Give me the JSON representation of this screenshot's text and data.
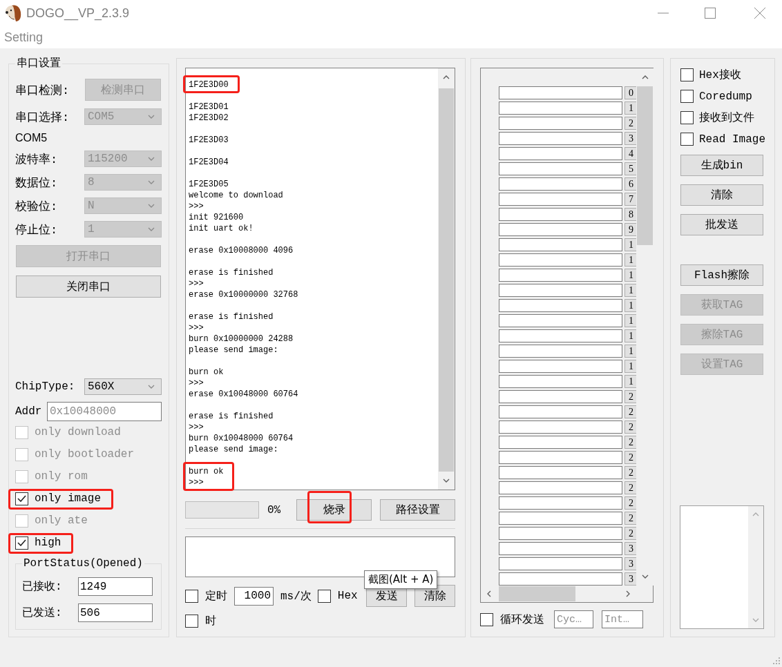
{
  "window": {
    "title": "DOGO__VP_2.3.9"
  },
  "menu": [
    {
      "label": "Setting"
    }
  ],
  "serial_settings": {
    "title": "串口设置",
    "detect": {
      "label": "串口检测:",
      "button": "检测串口",
      "disabled": true
    },
    "port_select": {
      "label": "串口选择:",
      "value": "COM5",
      "disabled": true
    },
    "port_name": "COM5",
    "params": [
      {
        "label": "波特率:",
        "value": "115200",
        "disabled": true
      },
      {
        "label": "数据位:",
        "value": "8",
        "disabled": true
      },
      {
        "label": "校验位:",
        "value": "N",
        "disabled": true
      },
      {
        "label": "停止位:",
        "value": "1",
        "disabled": true
      }
    ],
    "port_buttons": [
      {
        "label": "打开串口",
        "disabled": true
      },
      {
        "label": "关闭串口",
        "disabled": false
      }
    ],
    "chip_type": {
      "label": "ChipType:",
      "value": "560X",
      "disabled": false
    },
    "addr": {
      "label": "Addr",
      "placeholder": "0x10048000"
    },
    "options": [
      {
        "label": "only download",
        "checked": false,
        "disabled": true,
        "highlighted": false
      },
      {
        "label": "only bootloader",
        "checked": false,
        "disabled": true,
        "highlighted": false
      },
      {
        "label": "only rom",
        "checked": false,
        "disabled": true,
        "highlighted": false
      },
      {
        "label": "only image",
        "checked": true,
        "disabled": false,
        "highlighted": true
      },
      {
        "label": "only ate",
        "checked": false,
        "disabled": true,
        "highlighted": false
      },
      {
        "label": "high",
        "checked": true,
        "disabled": false,
        "highlighted": true
      }
    ],
    "port_status": {
      "title": "PortStatus(Opened)",
      "fields": [
        {
          "label": "已接收:",
          "value": "1249"
        },
        {
          "label": "已发送:",
          "value": "506"
        }
      ]
    }
  },
  "terminal": {
    "log": [
      {
        "lines": [
          "1F2E3D00"
        ],
        "highlighted": true
      },
      {
        "lines": [
          "1F2E3D01",
          "1F2E3D02"
        ],
        "highlighted": false
      },
      {
        "lines": [
          "1F2E3D03"
        ],
        "highlighted": false
      },
      {
        "lines": [
          "1F2E3D04"
        ],
        "highlighted": false
      },
      {
        "lines": [
          "1F2E3D05",
          "welcome to download",
          ">>>",
          "init 921600",
          "init uart ok!"
        ],
        "highlighted": false
      },
      {
        "lines": [
          "erase 0x10008000 4096"
        ],
        "highlighted": false
      },
      {
        "lines": [
          "erase is finished",
          ">>>",
          "erase 0x10000000 32768"
        ],
        "highlighted": false
      },
      {
        "lines": [
          "erase is finished",
          ">>>",
          "burn 0x10000000 24288",
          "please send image:"
        ],
        "highlighted": false
      },
      {
        "lines": [
          "burn ok",
          ">>>",
          "erase 0x10048000 60764"
        ],
        "highlighted": false
      },
      {
        "lines": [
          "erase is finished",
          ">>>",
          "burn 0x10048000 60764",
          "please send image:"
        ],
        "highlighted": false
      },
      {
        "lines": [
          "burn ok",
          ">>>"
        ],
        "highlighted": true
      }
    ],
    "progress": {
      "level": 0,
      "reading": "0%"
    },
    "burn_buttons": [
      {
        "label": "烧录",
        "highlighted": true
      },
      {
        "label": "路径设置",
        "highlighted": false
      }
    ],
    "send": {
      "timer": {
        "label": "定时",
        "checked": false
      },
      "interval": {
        "value": "1000",
        "unit": "ms/次"
      },
      "hex": {
        "label": "Hex",
        "checked": false
      },
      "buttons": [
        "发送",
        "清除"
      ],
      "timestamp": {
        "label": "时",
        "checked": false
      }
    }
  },
  "tooltip": {
    "text": "截图(Alt + A)"
  },
  "multi_send": {
    "row_labels": [
      "0",
      "1",
      "2",
      "3",
      "4",
      "5",
      "6",
      "7",
      "8",
      "9",
      "1",
      "1",
      "1",
      "1",
      "1",
      "1",
      "1",
      "1",
      "1",
      "1",
      "2",
      "2",
      "2",
      "2",
      "2",
      "2",
      "2",
      "2",
      "2",
      "2",
      "3",
      "3",
      "3"
    ],
    "loop": {
      "label": "循环发送",
      "checked": false
    },
    "fields": [
      {
        "placeholder": "Cyc…"
      },
      {
        "placeholder": "Int…"
      }
    ]
  },
  "receive": {
    "options": [
      {
        "label": "Hex接收",
        "checked": false
      },
      {
        "label": "Coredump",
        "checked": false
      },
      {
        "label": "接收到文件",
        "checked": false
      },
      {
        "label": "Read Image",
        "checked": false
      }
    ],
    "button_groups": [
      [
        {
          "label": "生成bin",
          "disabled": false
        },
        {
          "label": "清除",
          "disabled": false
        },
        {
          "label": "批发送",
          "disabled": false
        }
      ],
      [
        {
          "label": "Flash擦除",
          "disabled": false
        },
        {
          "label": "获取TAG",
          "disabled": true
        },
        {
          "label": "擦除TAG",
          "disabled": true
        },
        {
          "label": "设置TAG",
          "disabled": true
        }
      ]
    ]
  }
}
